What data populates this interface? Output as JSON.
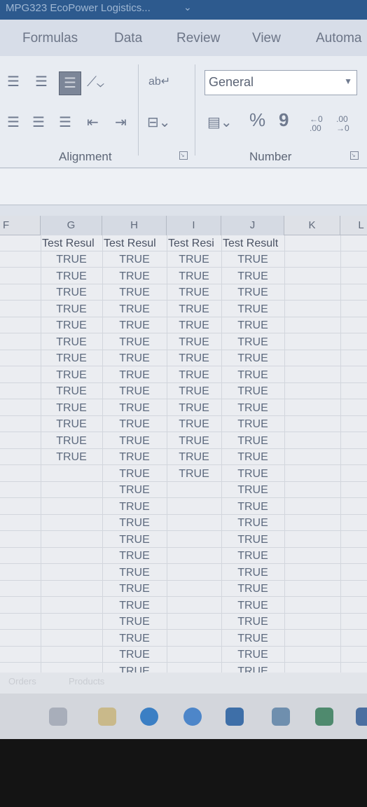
{
  "window": {
    "title": "MPG323 EcoPower Logistics..."
  },
  "ribbon_tabs": [
    "Formulas",
    "Data",
    "Review",
    "View",
    "Automa"
  ],
  "number_format": {
    "value": "General"
  },
  "groups": {
    "alignment": "Alignment",
    "number": "Number"
  },
  "icons": {
    "align_left": "align-left-icon",
    "wrap_text": "wrap-text-icon",
    "merge": "merge-center-icon",
    "currency": "accounting-format-icon",
    "percent": "%",
    "comma": "9",
    "increase_decimal": "←0 .00",
    "decrease_decimal": ".00 →0"
  },
  "columns": [
    "F",
    "G",
    "H",
    "I",
    "J",
    "K",
    "L"
  ],
  "header_row": [
    "Test Resul",
    "Test Resul",
    "Test Resi",
    "Test Result"
  ],
  "column_values": {
    "G": [
      "TRUE",
      "TRUE",
      "TRUE",
      "TRUE",
      "TRUE",
      "TRUE",
      "TRUE",
      "TRUE",
      "TRUE",
      "TRUE",
      "TRUE",
      "TRUE",
      "TRUE"
    ],
    "H": [
      "TRUE",
      "TRUE",
      "TRUE",
      "TRUE",
      "TRUE",
      "TRUE",
      "TRUE",
      "TRUE",
      "TRUE",
      "TRUE",
      "TRUE",
      "TRUE",
      "TRUE",
      "TRUE",
      "TRUE",
      "TRUE",
      "TRUE",
      "TRUE",
      "TRUE",
      "TRUE",
      "TRUE",
      "TRUE",
      "TRUE",
      "TRUE",
      "TRUE",
      "TRUE",
      "TRUE"
    ],
    "I": [
      "TRUE",
      "TRUE",
      "TRUE",
      "TRUE",
      "TRUE",
      "TRUE",
      "TRUE",
      "TRUE",
      "TRUE",
      "TRUE",
      "TRUE",
      "TRUE",
      "TRUE",
      "TRUE"
    ],
    "J": [
      "TRUE",
      "TRUE",
      "TRUE",
      "TRUE",
      "TRUE",
      "TRUE",
      "TRUE",
      "TRUE",
      "TRUE",
      "TRUE",
      "TRUE",
      "TRUE",
      "TRUE",
      "TRUE",
      "TRUE",
      "TRUE",
      "TRUE",
      "TRUE",
      "TRUE",
      "TRUE",
      "TRUE",
      "TRUE",
      "TRUE",
      "TRUE",
      "TRUE",
      "TRUE",
      "TRUE"
    ]
  },
  "sheet_tabs": [
    "Orders",
    "Products"
  ],
  "colors": {
    "titlebar": "#2d5a8e",
    "ribbon": "#e8ecf2",
    "grid": "#ebedf1",
    "cell_text": "#5d6a7e"
  }
}
